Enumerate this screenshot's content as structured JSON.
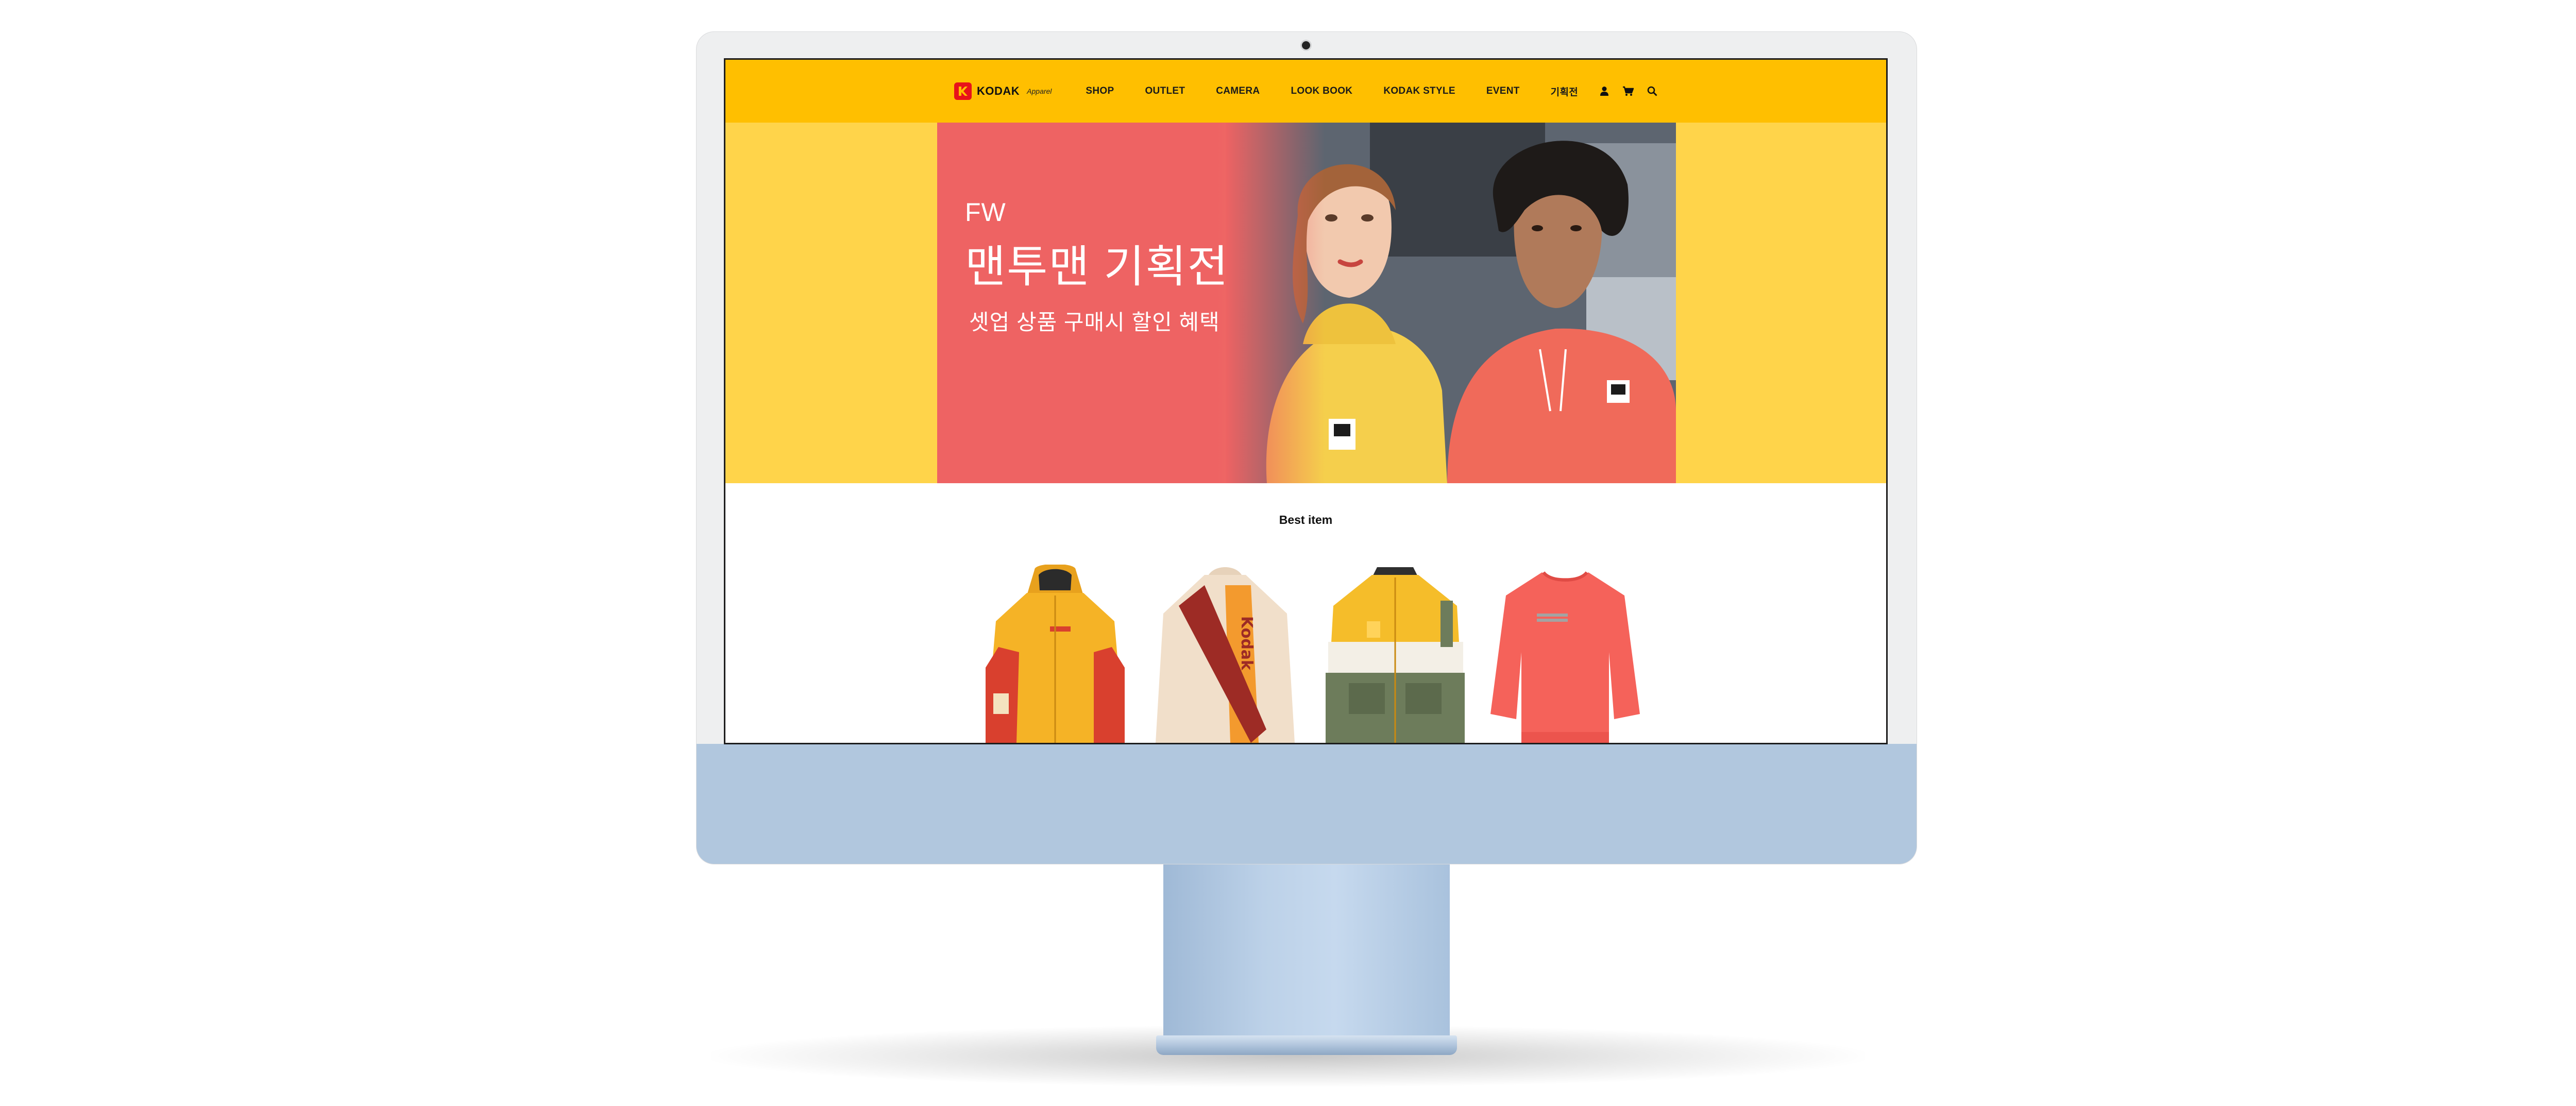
{
  "navbar": {
    "brand_name": "KODAK",
    "brand_sub": "Apparel",
    "items": [
      {
        "label": "SHOP"
      },
      {
        "label": "OUTLET"
      },
      {
        "label": "CAMERA"
      },
      {
        "label": "LOOK BOOK"
      },
      {
        "label": "KODAK STYLE"
      },
      {
        "label": "EVENT"
      },
      {
        "label": "기획전"
      }
    ],
    "icons": [
      "user-icon",
      "cart-icon",
      "search-icon"
    ]
  },
  "hero": {
    "eyebrow": "FW",
    "title": "맨투맨 기획전",
    "subtitle": "셋업 상품 구매시 할인 혜택"
  },
  "best": {
    "title": "Best item",
    "products": [
      {
        "name": "yellow-red-parka"
      },
      {
        "name": "cream-fleece-jacket",
        "print": "Kodak"
      },
      {
        "name": "yellow-khaki-jacket"
      },
      {
        "name": "coral-sweatshirt"
      }
    ]
  },
  "colors": {
    "nav_bg": "#ffbf00",
    "hero_bg": "#ffd44a",
    "banner_coral": "#ee6363",
    "kodak_red": "#e8121a",
    "monitor_chin": "#b1c7de"
  }
}
